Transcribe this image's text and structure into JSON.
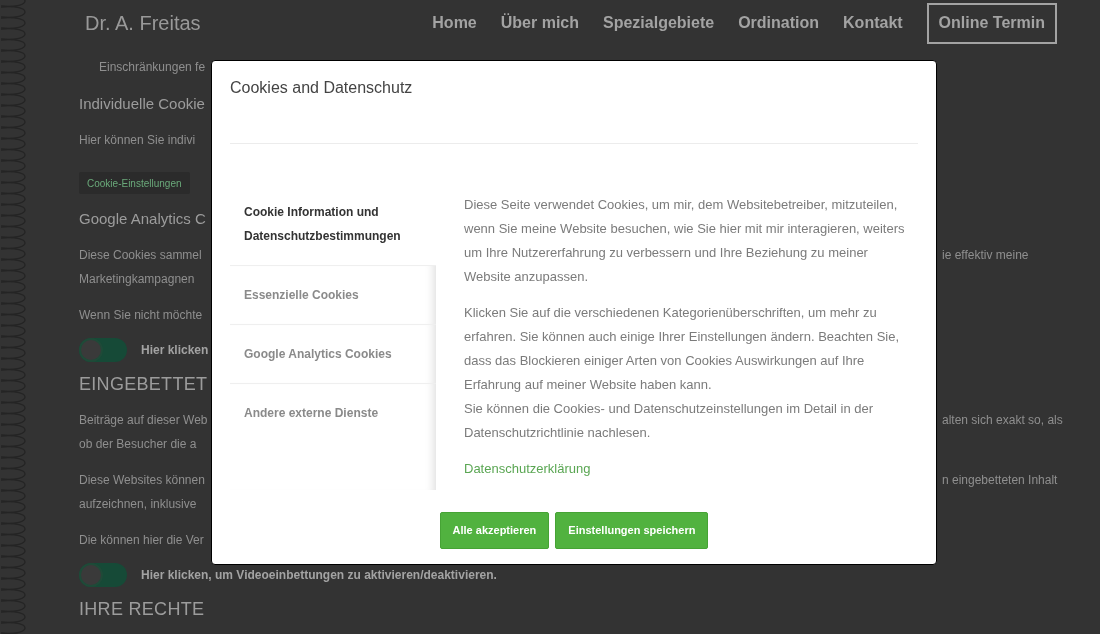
{
  "header": {
    "brand": "Dr. A. Freitas",
    "nav": [
      "Home",
      "Über mich",
      "Spezialgebiete",
      "Ordination",
      "Kontakt"
    ],
    "cta": "Online Termin"
  },
  "page": {
    "content": [
      {
        "kind": "list_item",
        "lines": [
          {
            "left": "Einschränkungen fe"
          }
        ]
      },
      {
        "kind": "heading",
        "text": "Individuelle Cookie"
      },
      {
        "kind": "paragraph",
        "lines": [
          {
            "left": "Hier können Sie indivi"
          }
        ]
      },
      {
        "kind": "button",
        "label": "Cookie-Einstellungen"
      },
      {
        "kind": "heading",
        "text": "Google Analytics C"
      },
      {
        "kind": "paragraph",
        "lines": [
          {
            "left": "Diese Cookies sammel",
            "right": "ie effektiv meine"
          },
          {
            "left": "Marketingkampagnen"
          }
        ]
      },
      {
        "kind": "paragraph",
        "lines": [
          {
            "left": "Wenn Sie nicht möchte"
          }
        ]
      },
      {
        "kind": "toggle",
        "on": false,
        "label": "Hier klicken"
      },
      {
        "kind": "section_heading",
        "text": "EINGEBETTET"
      },
      {
        "kind": "paragraph",
        "lines": [
          {
            "left": "Beiträge auf dieser Web",
            "right": "alten sich exakt so, als"
          },
          {
            "left": "ob der Besucher die a"
          }
        ]
      },
      {
        "kind": "paragraph",
        "lines": [
          {
            "left": "Diese Websites können",
            "right": "n eingebetteten Inhalt"
          },
          {
            "left": "aufzeichnen, inklusive"
          }
        ]
      },
      {
        "kind": "paragraph",
        "lines": [
          {
            "left": "Die können hier die Ver"
          }
        ]
      },
      {
        "kind": "toggle",
        "on": false,
        "label": "Hier klicken, um Videoeinbettungen zu aktivieren/deaktivieren."
      },
      {
        "kind": "section_heading",
        "text": "IHRE RECHTE"
      }
    ]
  },
  "cookie_dialog": {
    "title": "Cookies and Datenschutz",
    "tabs": [
      {
        "label": "Cookie Information und Datenschutzbestimmungen",
        "selected": true
      },
      {
        "label": "Essenzielle Cookies",
        "selected": false
      },
      {
        "label": "Google Analytics Cookies",
        "selected": false
      },
      {
        "label": "Andere externe Dienste",
        "selected": false
      }
    ],
    "paragraphs": [
      [
        "Diese Seite verwendet Cookies, um mir, dem Websitebetreiber, mitzuteilen, wenn Sie meine Website besuchen, wie Sie hier mit mir interagieren, weiters um Ihre Nutzererfahrung zu verbessern und Ihre Beziehung zu meiner Website anzupassen."
      ],
      [
        "Klicken Sie auf die verschiedenen Kategorienüberschriften, um mehr zu erfahren. Sie können auch einige Ihrer Einstellungen ändern. Beachten Sie, dass das Blockieren einiger Arten von Cookies Auswirkungen auf Ihre Erfahrung auf meiner Website haben kann.",
        "Sie können die Cookies- und Datenschutzeinstellungen im Detail in der Datenschutzrichtlinie nachlesen."
      ]
    ],
    "link": "Datenschutzerklärung",
    "buttons": [
      "Alle akzeptieren",
      "Einstellungen speichern"
    ]
  }
}
